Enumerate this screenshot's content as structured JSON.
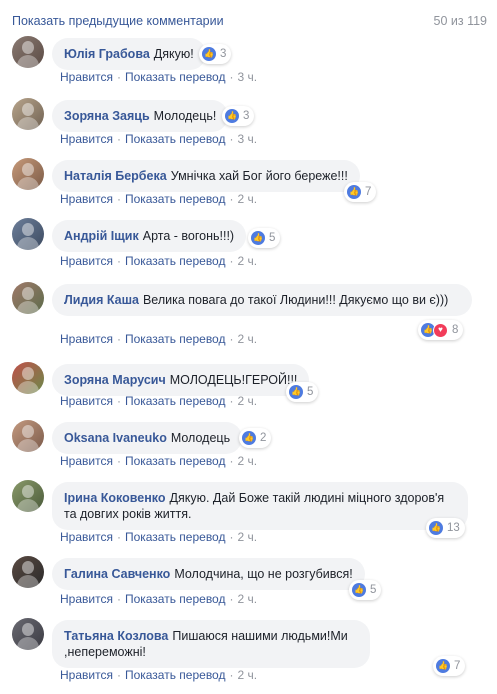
{
  "header": {
    "previous_comments_label": "Показать предыдущие комментарии",
    "count_label": "50 из 119"
  },
  "action_labels": {
    "like": "Нравится",
    "translate": "Показать перевод",
    "separator": "·"
  },
  "icons": {
    "like": "thumbs-up-icon",
    "love": "heart-icon"
  },
  "colors": {
    "link": "#385898",
    "bubble": "#f2f3f5",
    "like_blue": "#4e7be0",
    "love_red": "#f23c5a",
    "meta_gray": "#90949c"
  },
  "comments": [
    {
      "author": "Юлія Грабова",
      "text": "Дякую!",
      "reactions": "3",
      "time": "3 ч."
    },
    {
      "author": "Зоряна Заяць",
      "text": "Молодець!",
      "reactions": "3",
      "time": "3 ч."
    },
    {
      "author": "Наталія Бербека",
      "text": "Умнічка хай Бог його береже!!!",
      "reactions": "7",
      "time": "2 ч."
    },
    {
      "author": "Андрій Іщик",
      "text": "Арта - вогонь!!!)",
      "reactions": "5",
      "time": "2 ч."
    },
    {
      "author": "Лидия Каша",
      "text": "Велика повага до такої Людини!!! Дякуємо що ви є)))",
      "reactions": "8",
      "time": "2 ч."
    },
    {
      "author": "Зоряна Марусич",
      "text": "МОЛОДЕЦЬ!ГЕРОЙ!!!",
      "reactions": "5",
      "time": "2 ч."
    },
    {
      "author": "Oksana Ivaneuko",
      "text": "Молодець",
      "reactions": "2",
      "time": "2 ч."
    },
    {
      "author": "Ірина Коковенко",
      "text": "Дякую. Дай Боже такій людині міцного здоров'я та довгих років життя.",
      "reactions": "13",
      "time": "2 ч."
    },
    {
      "author": "Галина Савченко",
      "text": "Молодчина, що не розгубився!",
      "reactions": "5",
      "time": "2 ч."
    },
    {
      "author": "Татьяна Козлова",
      "text": "Пишаюся нашими людьми!Ми ,непереможні!",
      "reactions": "7",
      "time": "2 ч."
    }
  ]
}
